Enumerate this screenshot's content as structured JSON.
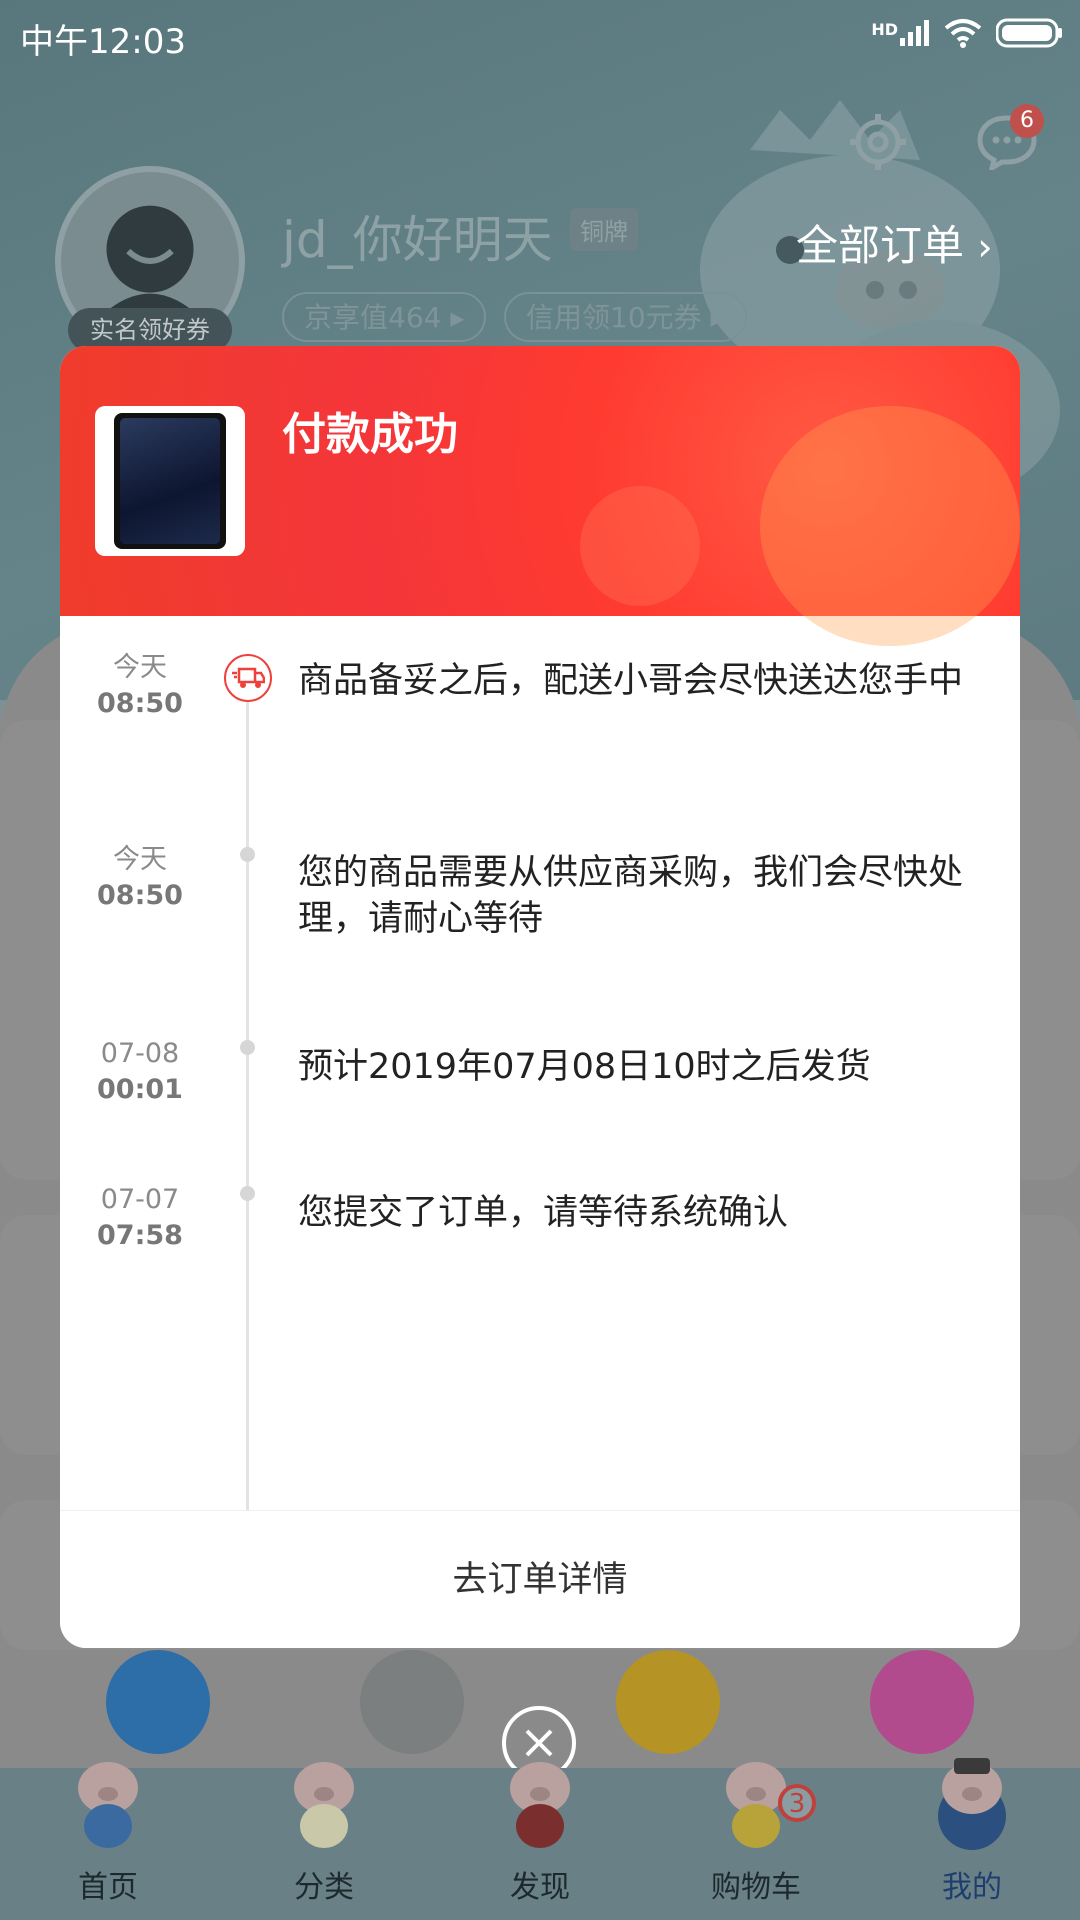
{
  "status_bar": {
    "time": "中午12:03",
    "network": "HD"
  },
  "profile": {
    "username": "jd_你好明天",
    "level": "铜牌",
    "avatar_tag": "实名领好券",
    "pills": [
      "京享值464",
      "信用领10元券"
    ],
    "all_orders": "全部订单",
    "message_count": "6"
  },
  "modal": {
    "title": "付款成功",
    "timeline": [
      {
        "date": "今天",
        "time": "08:50",
        "text": "商品备妥之后，配送小哥会尽快送达您手中"
      },
      {
        "date": "今天",
        "time": "08:50",
        "text": "您的商品需要从供应商采购，我们会尽快处理，请耐心等待"
      },
      {
        "date": "07-08",
        "time": "00:01",
        "text": "预计2019年07月08日10时之后发货"
      },
      {
        "date": "07-07",
        "time": "07:58",
        "text": "您提交了订单，请等待系统确认"
      }
    ],
    "footer_button": "去订单详情"
  },
  "tabbar": {
    "items": [
      {
        "label": "首页"
      },
      {
        "label": "分类"
      },
      {
        "label": "发现"
      },
      {
        "label": "购物车",
        "badge": "3"
      },
      {
        "label": "我的"
      }
    ],
    "active": "我的"
  },
  "colors": {
    "accent": "#f4363a",
    "background_dim": "#7f9094",
    "tab_active": "#1e3e6e"
  }
}
